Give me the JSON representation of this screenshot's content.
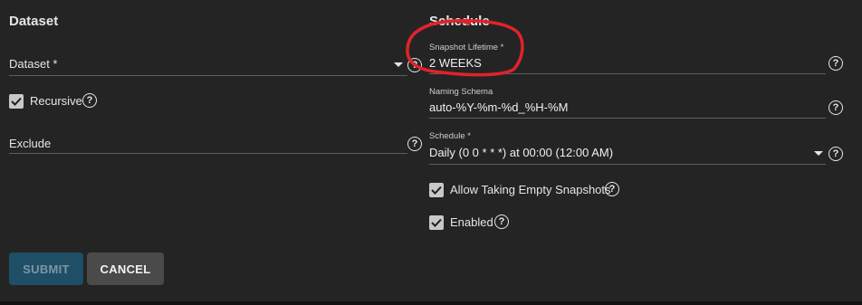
{
  "dataset_section": {
    "title": "Dataset",
    "dataset_label": "Dataset *",
    "recursive_label": "Recursive",
    "exclude_label": "Exclude"
  },
  "schedule_section": {
    "title": "Schedule",
    "lifetime_label": "Snapshot Lifetime *",
    "lifetime_value": "2 WEEKS",
    "naming_label": "Naming Schema",
    "naming_value": "auto-%Y-%m-%d_%H-%M",
    "schedule_label": "Schedule *",
    "schedule_value": "Daily (0 0 * * *) at 00:00 (12:00 AM)",
    "allow_empty_label": "Allow Taking Empty Snapshots",
    "enabled_label": "Enabled"
  },
  "buttons": {
    "submit": "SUBMIT",
    "cancel": "CANCEL"
  },
  "help_glyph": "?",
  "colors": {
    "background": "#242424",
    "submit_bg": "#1f4f66",
    "cancel_bg": "#4a4a4a",
    "annotation": "#e0232b"
  }
}
